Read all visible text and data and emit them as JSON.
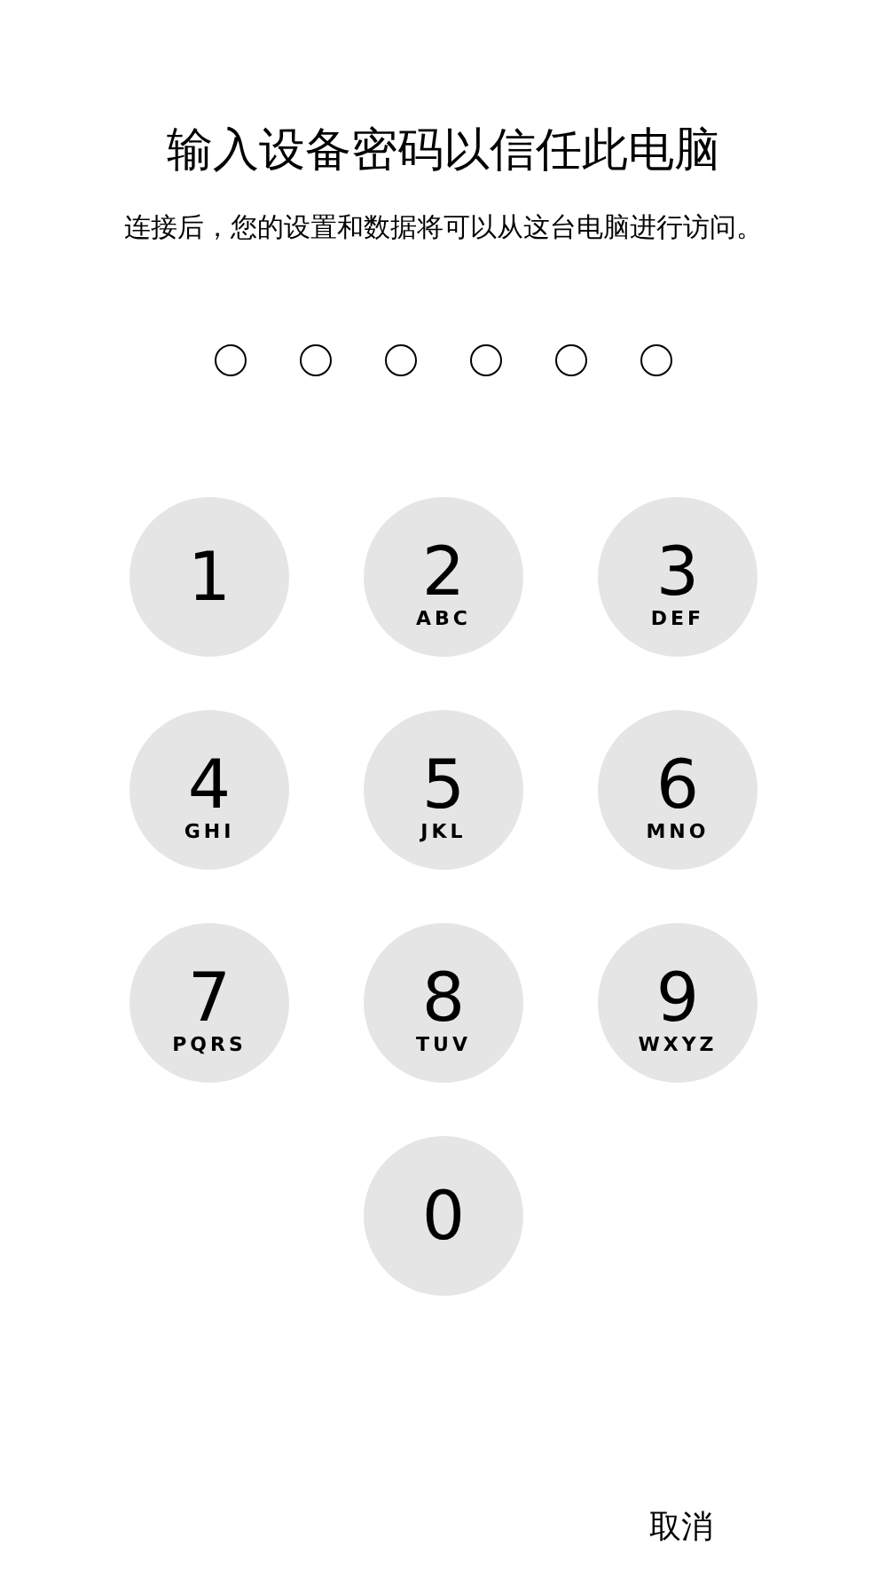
{
  "title": "输入设备密码以信任此电脑",
  "subtitle": "连接后，您的设置和数据将可以从这台电脑进行访问。",
  "passcode_dots": [
    {
      "filled": false
    },
    {
      "filled": false
    },
    {
      "filled": false
    },
    {
      "filled": false
    },
    {
      "filled": false
    },
    {
      "filled": false
    }
  ],
  "keys": [
    {
      "digit": "1"
    },
    {
      "digit": "2",
      "letters": "ABC"
    },
    {
      "digit": "3",
      "letters": "DEF"
    },
    {
      "digit": "4",
      "letters": "GHI"
    },
    {
      "digit": "5",
      "letters": "JKL"
    },
    {
      "digit": "6",
      "letters": "MNO"
    },
    {
      "digit": "7",
      "letters": "PQRS"
    },
    {
      "digit": "8",
      "letters": "TUV"
    },
    {
      "digit": "9",
      "letters": "WXYZ"
    },
    {
      "digit": "0"
    }
  ],
  "cancel": "取消"
}
